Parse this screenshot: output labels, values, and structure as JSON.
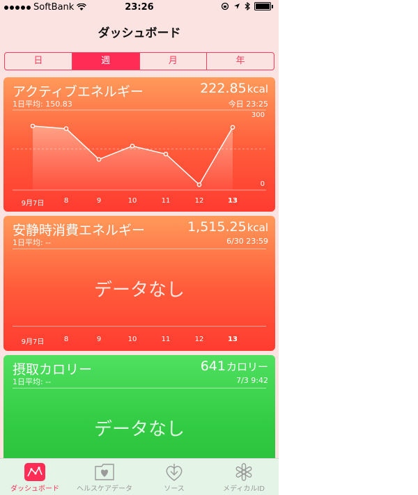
{
  "status": {
    "carrier": "SoftBank",
    "time": "23:26"
  },
  "nav": {
    "title": "ダッシュボード"
  },
  "segments": [
    "日",
    "週",
    "月",
    "年"
  ],
  "cards": [
    {
      "title": "アクティブエネルギー",
      "avg": "1日平均: 150.83",
      "value": "222.85",
      "unit": "kcal",
      "date": "今日 23:25",
      "ymax_label": "300",
      "ymin_label": "0",
      "x_labels": [
        "9月7日",
        "8",
        "9",
        "10",
        "11",
        "12",
        "13"
      ]
    },
    {
      "title": "安静時消費エネルギー",
      "avg": "1日平均: --",
      "value": "1,515.25",
      "unit": "kcal",
      "date": "6/30 23:59",
      "nodata": "データなし",
      "x_labels": [
        "9月7日",
        "8",
        "9",
        "10",
        "11",
        "12",
        "13"
      ]
    },
    {
      "title": "摂取カロリー",
      "avg": "1日平均: --",
      "value": "641",
      "unit": "カロリー",
      "date": "7/3 9:42",
      "nodata": "データなし"
    }
  ],
  "chart_data": {
    "type": "line",
    "categories": [
      "9月7日",
      "8",
      "9",
      "10",
      "11",
      "12",
      "13"
    ],
    "values": [
      240,
      230,
      115,
      165,
      135,
      20,
      235
    ],
    "ylim": [
      0,
      300
    ]
  },
  "tabs": [
    {
      "label": "ダッシュボード",
      "icon": "dashboard-icon",
      "active": true
    },
    {
      "label": "ヘルスケアデータ",
      "icon": "health-data-icon",
      "active": false
    },
    {
      "label": "ソース",
      "icon": "sources-icon",
      "active": false
    },
    {
      "label": "メディカルID",
      "icon": "medical-id-icon",
      "active": false
    }
  ]
}
